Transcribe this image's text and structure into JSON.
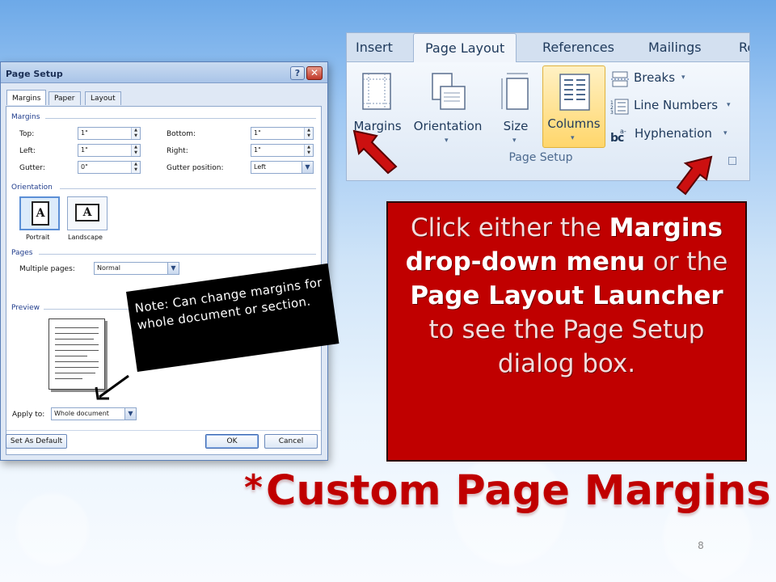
{
  "slide": {
    "title_star": "*",
    "title": "Custom Page Margins",
    "page_number": "8"
  },
  "dialog": {
    "title": "Page Setup",
    "help_glyph": "?",
    "close_glyph": "✕",
    "tabs": [
      "Margins",
      "Paper",
      "Layout"
    ],
    "margins_group": "Margins",
    "top_label": "Top:",
    "top_value": "1\"",
    "bottom_label": "Bottom:",
    "bottom_value": "1\"",
    "left_label": "Left:",
    "left_value": "1\"",
    "right_label": "Right:",
    "right_value": "1\"",
    "gutter_label": "Gutter:",
    "gutter_value": "0\"",
    "gutter_pos_label": "Gutter position:",
    "gutter_pos_value": "Left",
    "orientation_group": "Orientation",
    "portrait_label": "Portrait",
    "landscape_label": "Landscape",
    "orient_letter": "A",
    "pages_group": "Pages",
    "multiple_pages_label": "Multiple pages:",
    "multiple_pages_value": "Normal",
    "preview_group": "Preview",
    "apply_to_label": "Apply to:",
    "apply_to_value": "Whole document",
    "set_default": "Set As Default",
    "ok": "OK",
    "cancel": "Cancel"
  },
  "ribbon": {
    "tabs": [
      "Insert",
      "Page Layout",
      "References",
      "Mailings",
      "Re"
    ],
    "margins": "Margins",
    "orientation": "Orientation",
    "size": "Size",
    "columns": "Columns",
    "breaks": "Breaks",
    "line_numbers": "Line Numbers",
    "hyphenation": "Hyphenation",
    "group_label": "Page Setup",
    "caret": "▾"
  },
  "note": {
    "text": "Note: Can change margins for whole document or section."
  },
  "callout": {
    "t1": "Click either the ",
    "b1": "Margins drop-down menu",
    "t2": " or the ",
    "b2": "Page Layout Launcher",
    "t3": " to see the Page Setup dialog box."
  },
  "colors": {
    "accent_red": "#c00000",
    "ribbon_text": "#1e395b",
    "highlight": "#ffd66b"
  }
}
